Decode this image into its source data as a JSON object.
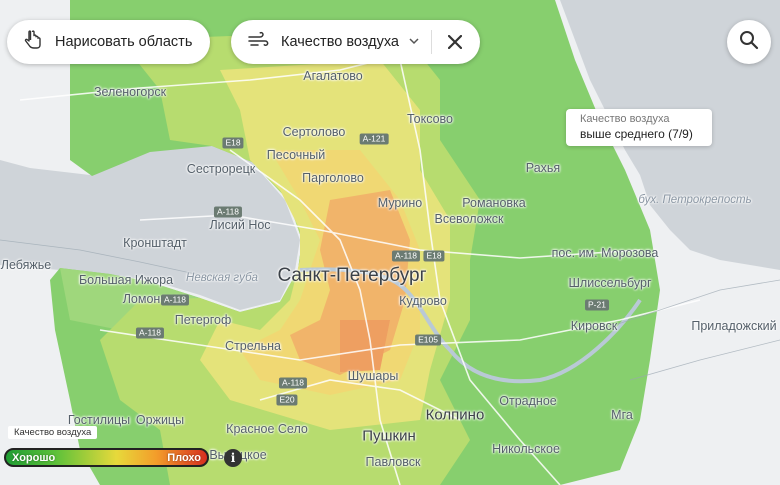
{
  "controls": {
    "draw_area_label": "Нарисовать область",
    "air_quality_label": "Качество воздуха",
    "draw_icon": "hand-pointer-icon",
    "air_icon": "wind-icon",
    "dropdown_icon": "chevron-down-icon",
    "close_icon": "close-icon",
    "search_icon": "search-icon"
  },
  "tooltip": {
    "title": "Качество воздуха",
    "value": "выше среднего (7/9)"
  },
  "legend": {
    "title": "Качество воздуха",
    "good_label": "Хорошо",
    "bad_label": "Плохо",
    "info_icon": "info-icon",
    "colors": [
      "#1f9d33",
      "#5ec13a",
      "#e7d93b",
      "#f39c2a",
      "#d62e1f"
    ]
  },
  "map": {
    "places": [
      {
        "name": "Агалатово"
      },
      {
        "name": "Зеленогорск"
      },
      {
        "name": "Токсово"
      },
      {
        "name": "Сертолово"
      },
      {
        "name": "Песочный"
      },
      {
        "name": "Сестрорецк"
      },
      {
        "name": "Парголово"
      },
      {
        "name": "Рахья"
      },
      {
        "name": "Мурино"
      },
      {
        "name": "Романовка"
      },
      {
        "name": "Всеволожск"
      },
      {
        "name": "Лисий Нос"
      },
      {
        "name": "Кронштадт"
      },
      {
        "name": "Лебяжье"
      },
      {
        "name": "Большая Ижора"
      },
      {
        "name": "Санкт-Петербург"
      },
      {
        "name": "Кудрово"
      },
      {
        "name": "пос. им. Морозова"
      },
      {
        "name": "Шлиссельбург"
      },
      {
        "name": "Ломоносов"
      },
      {
        "name": "Петергоф"
      },
      {
        "name": "Кировск"
      },
      {
        "name": "Приладожский"
      },
      {
        "name": "Стрельна"
      },
      {
        "name": "Шушары"
      },
      {
        "name": "Отрадное"
      },
      {
        "name": "Гостилицы"
      },
      {
        "name": "Оржицы"
      },
      {
        "name": "Колпино"
      },
      {
        "name": "Мга"
      },
      {
        "name": "Красное Село"
      },
      {
        "name": "Пушкин"
      },
      {
        "name": "Никольское"
      },
      {
        "name": "Павловск"
      },
      {
        "name": "Высоцкое"
      }
    ],
    "water_labels": [
      {
        "name": "Невская губа"
      },
      {
        "name": "бух. Петрокрепость"
      }
    ],
    "road_shields": [
      {
        "name": "А-121"
      },
      {
        "name": "E18"
      },
      {
        "name": "А-118"
      },
      {
        "name": "А-118"
      },
      {
        "name": "E105"
      },
      {
        "name": "Р-21"
      },
      {
        "name": "А-118"
      },
      {
        "name": "А-118"
      },
      {
        "name": "E20"
      },
      {
        "name": "E18"
      },
      {
        "name": "А-118"
      }
    ]
  }
}
